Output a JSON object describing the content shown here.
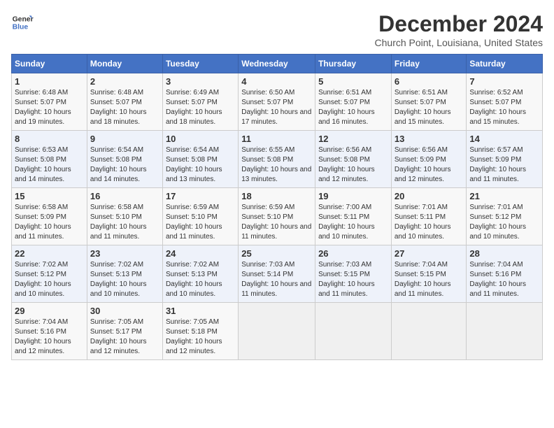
{
  "header": {
    "logo_line1": "General",
    "logo_line2": "Blue",
    "month": "December 2024",
    "location": "Church Point, Louisiana, United States"
  },
  "days_of_week": [
    "Sunday",
    "Monday",
    "Tuesday",
    "Wednesday",
    "Thursday",
    "Friday",
    "Saturday"
  ],
  "weeks": [
    [
      {
        "day": "1",
        "sunrise": "6:48 AM",
        "sunset": "5:07 PM",
        "daylight": "10 hours and 19 minutes."
      },
      {
        "day": "2",
        "sunrise": "6:48 AM",
        "sunset": "5:07 PM",
        "daylight": "10 hours and 18 minutes."
      },
      {
        "day": "3",
        "sunrise": "6:49 AM",
        "sunset": "5:07 PM",
        "daylight": "10 hours and 18 minutes."
      },
      {
        "day": "4",
        "sunrise": "6:50 AM",
        "sunset": "5:07 PM",
        "daylight": "10 hours and 17 minutes."
      },
      {
        "day": "5",
        "sunrise": "6:51 AM",
        "sunset": "5:07 PM",
        "daylight": "10 hours and 16 minutes."
      },
      {
        "day": "6",
        "sunrise": "6:51 AM",
        "sunset": "5:07 PM",
        "daylight": "10 hours and 15 minutes."
      },
      {
        "day": "7",
        "sunrise": "6:52 AM",
        "sunset": "5:07 PM",
        "daylight": "10 hours and 15 minutes."
      }
    ],
    [
      {
        "day": "8",
        "sunrise": "6:53 AM",
        "sunset": "5:08 PM",
        "daylight": "10 hours and 14 minutes."
      },
      {
        "day": "9",
        "sunrise": "6:54 AM",
        "sunset": "5:08 PM",
        "daylight": "10 hours and 14 minutes."
      },
      {
        "day": "10",
        "sunrise": "6:54 AM",
        "sunset": "5:08 PM",
        "daylight": "10 hours and 13 minutes."
      },
      {
        "day": "11",
        "sunrise": "6:55 AM",
        "sunset": "5:08 PM",
        "daylight": "10 hours and 13 minutes."
      },
      {
        "day": "12",
        "sunrise": "6:56 AM",
        "sunset": "5:08 PM",
        "daylight": "10 hours and 12 minutes."
      },
      {
        "day": "13",
        "sunrise": "6:56 AM",
        "sunset": "5:09 PM",
        "daylight": "10 hours and 12 minutes."
      },
      {
        "day": "14",
        "sunrise": "6:57 AM",
        "sunset": "5:09 PM",
        "daylight": "10 hours and 11 minutes."
      }
    ],
    [
      {
        "day": "15",
        "sunrise": "6:58 AM",
        "sunset": "5:09 PM",
        "daylight": "10 hours and 11 minutes."
      },
      {
        "day": "16",
        "sunrise": "6:58 AM",
        "sunset": "5:10 PM",
        "daylight": "10 hours and 11 minutes."
      },
      {
        "day": "17",
        "sunrise": "6:59 AM",
        "sunset": "5:10 PM",
        "daylight": "10 hours and 11 minutes."
      },
      {
        "day": "18",
        "sunrise": "6:59 AM",
        "sunset": "5:10 PM",
        "daylight": "10 hours and 11 minutes."
      },
      {
        "day": "19",
        "sunrise": "7:00 AM",
        "sunset": "5:11 PM",
        "daylight": "10 hours and 10 minutes."
      },
      {
        "day": "20",
        "sunrise": "7:01 AM",
        "sunset": "5:11 PM",
        "daylight": "10 hours and 10 minutes."
      },
      {
        "day": "21",
        "sunrise": "7:01 AM",
        "sunset": "5:12 PM",
        "daylight": "10 hours and 10 minutes."
      }
    ],
    [
      {
        "day": "22",
        "sunrise": "7:02 AM",
        "sunset": "5:12 PM",
        "daylight": "10 hours and 10 minutes."
      },
      {
        "day": "23",
        "sunrise": "7:02 AM",
        "sunset": "5:13 PM",
        "daylight": "10 hours and 10 minutes."
      },
      {
        "day": "24",
        "sunrise": "7:02 AM",
        "sunset": "5:13 PM",
        "daylight": "10 hours and 10 minutes."
      },
      {
        "day": "25",
        "sunrise": "7:03 AM",
        "sunset": "5:14 PM",
        "daylight": "10 hours and 11 minutes."
      },
      {
        "day": "26",
        "sunrise": "7:03 AM",
        "sunset": "5:15 PM",
        "daylight": "10 hours and 11 minutes."
      },
      {
        "day": "27",
        "sunrise": "7:04 AM",
        "sunset": "5:15 PM",
        "daylight": "10 hours and 11 minutes."
      },
      {
        "day": "28",
        "sunrise": "7:04 AM",
        "sunset": "5:16 PM",
        "daylight": "10 hours and 11 minutes."
      }
    ],
    [
      {
        "day": "29",
        "sunrise": "7:04 AM",
        "sunset": "5:16 PM",
        "daylight": "10 hours and 12 minutes."
      },
      {
        "day": "30",
        "sunrise": "7:05 AM",
        "sunset": "5:17 PM",
        "daylight": "10 hours and 12 minutes."
      },
      {
        "day": "31",
        "sunrise": "7:05 AM",
        "sunset": "5:18 PM",
        "daylight": "10 hours and 12 minutes."
      },
      null,
      null,
      null,
      null
    ]
  ]
}
